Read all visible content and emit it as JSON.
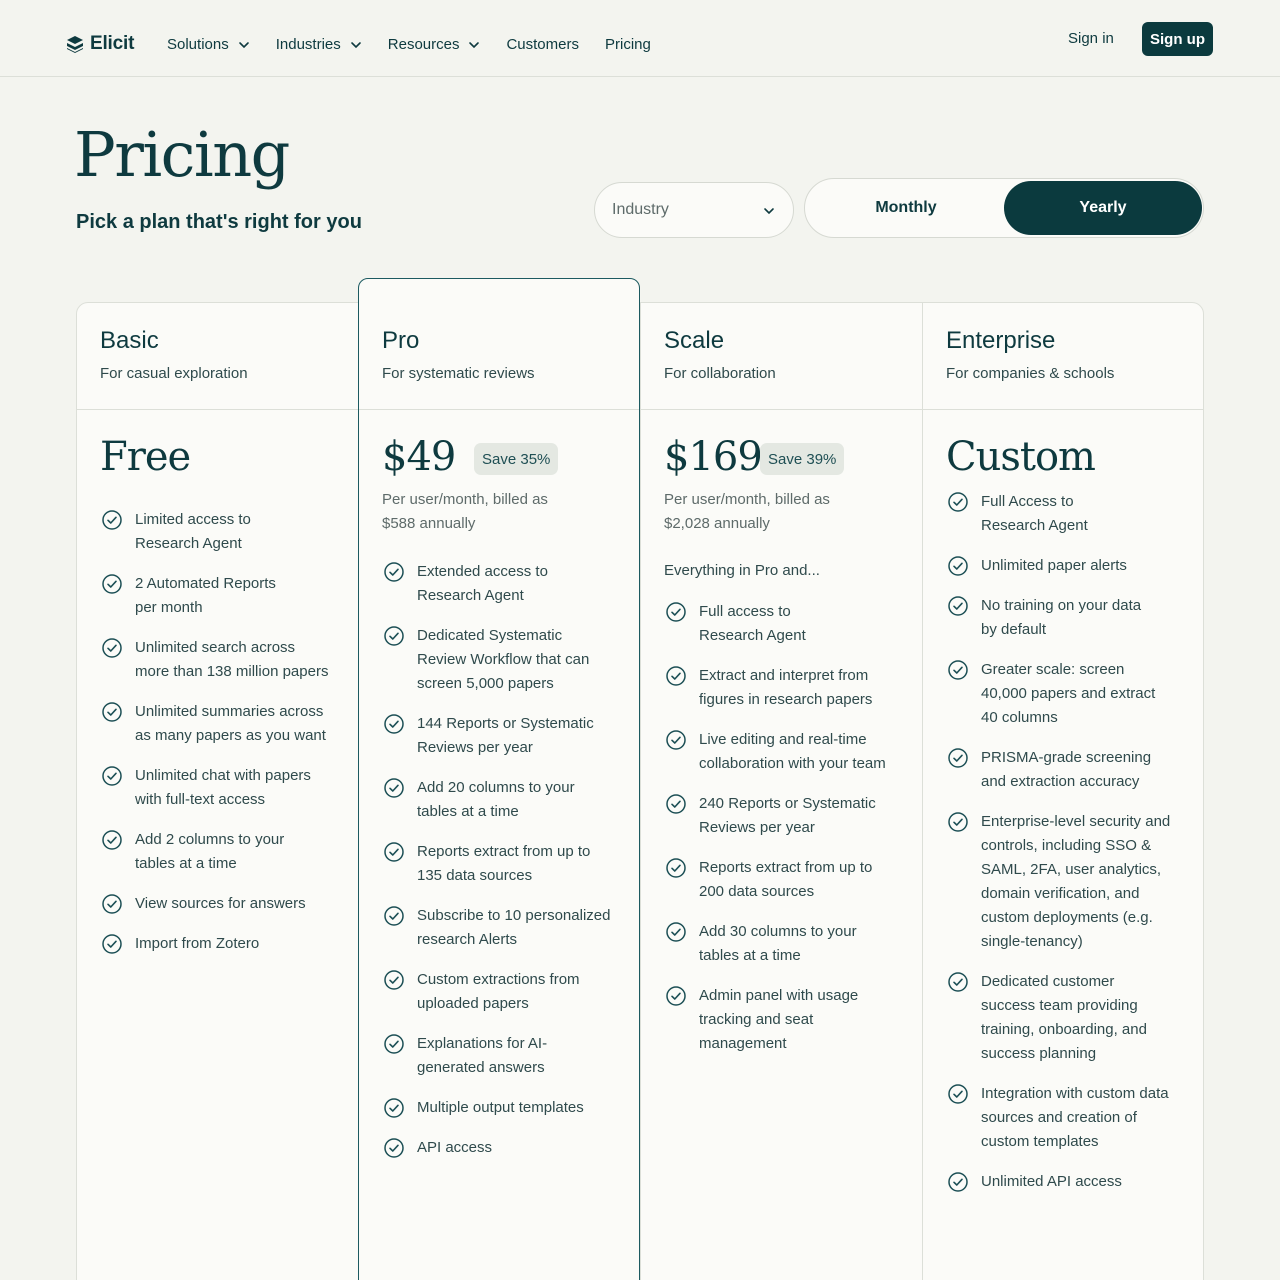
{
  "nav": {
    "brand": "Elicit",
    "links": [
      {
        "label": "Solutions",
        "dropdown": true
      },
      {
        "label": "Industries",
        "dropdown": true
      },
      {
        "label": "Resources",
        "dropdown": true
      },
      {
        "label": "Customers",
        "dropdown": false
      },
      {
        "label": "Pricing",
        "dropdown": false
      }
    ],
    "sign_in": "Sign in",
    "sign_up": "Sign up"
  },
  "header": {
    "title": "Pricing",
    "subtitle": "Pick a plan that's right for you",
    "industry_placeholder": "Industry",
    "billing": {
      "monthly": "Monthly",
      "yearly": "Yearly",
      "selected": "Yearly"
    }
  },
  "colors": {
    "brand_dark": "#0b3a3e",
    "text": "#0e3a3f",
    "page_bg": "#f3f4ef",
    "card_bg": "#fbfbf8",
    "badge_bg": "#e4e8e2"
  },
  "plans": [
    {
      "name": "Basic",
      "tagline": "For casual exploration",
      "price": "Free",
      "features": [
        [
          "Limited access to",
          "Research Agent"
        ],
        [
          "2 Automated Reports",
          "per month"
        ],
        [
          "Unlimited search across",
          "more than 138 million papers"
        ],
        [
          "Unlimited summaries across",
          "as many papers as you want"
        ],
        [
          "Unlimited chat with papers",
          "with full-text access"
        ],
        [
          "Add 2 columns to your",
          "tables at a time"
        ],
        [
          "View sources for answers"
        ],
        [
          "Import from Zotero"
        ]
      ]
    },
    {
      "name": "Pro",
      "tagline": "For systematic reviews",
      "price": "$49",
      "save": "Save 35%",
      "billed": [
        "Per user/month, billed as",
        "$588 annually"
      ],
      "features": [
        [
          "Extended access to",
          "Research Agent"
        ],
        [
          "Dedicated Systematic",
          "Review Workflow that can",
          "screen 5,000 papers"
        ],
        [
          "144 Reports or Systematic",
          "Reviews per year"
        ],
        [
          "Add 20 columns to your",
          "tables at a time"
        ],
        [
          "Reports extract from up to",
          "135 data sources"
        ],
        [
          "Subscribe to 10 personalized",
          "research Alerts"
        ],
        [
          "Custom extractions from",
          "uploaded papers"
        ],
        [
          "Explanations for AI-",
          "generated answers"
        ],
        [
          "Multiple output templates"
        ],
        [
          "API access"
        ]
      ]
    },
    {
      "name": "Scale",
      "tagline": "For collaboration",
      "price": "$169",
      "save": "Save 39%",
      "billed": [
        "Per user/month, billed as",
        "$2,028 annually"
      ],
      "intro": "Everything in Pro and...",
      "features": [
        [
          "Full access to",
          "Research Agent"
        ],
        [
          "Extract and interpret from",
          "figures in research papers"
        ],
        [
          "Live editing and real-time",
          "collaboration with your team"
        ],
        [
          "240 Reports or Systematic",
          "Reviews per year"
        ],
        [
          "Reports extract from up to",
          "200 data sources"
        ],
        [
          "Add 30 columns to your",
          "tables at a time"
        ],
        [
          "Admin panel with usage",
          "tracking and seat",
          "management"
        ]
      ]
    },
    {
      "name": "Enterprise",
      "tagline": "For companies & schools",
      "price": "Custom",
      "features": [
        [
          "Full Access to",
          "Research Agent"
        ],
        [
          "Unlimited paper alerts"
        ],
        [
          "No training on your data",
          "by default"
        ],
        [
          "Greater scale: screen",
          "40,000 papers and extract",
          "40 columns"
        ],
        [
          "PRISMA-grade screening",
          "and extraction accuracy"
        ],
        [
          "Enterprise-level security and",
          "controls, including SSO &",
          "SAML, 2FA, user analytics,",
          "domain verification, and",
          "custom deployments (e.g.",
          "single-tenancy)"
        ],
        [
          "Dedicated customer",
          "success team providing",
          "training, onboarding, and",
          "success planning"
        ],
        [
          "Integration with custom data",
          "sources and creation of",
          "custom templates"
        ],
        [
          "Unlimited API access"
        ]
      ]
    }
  ]
}
